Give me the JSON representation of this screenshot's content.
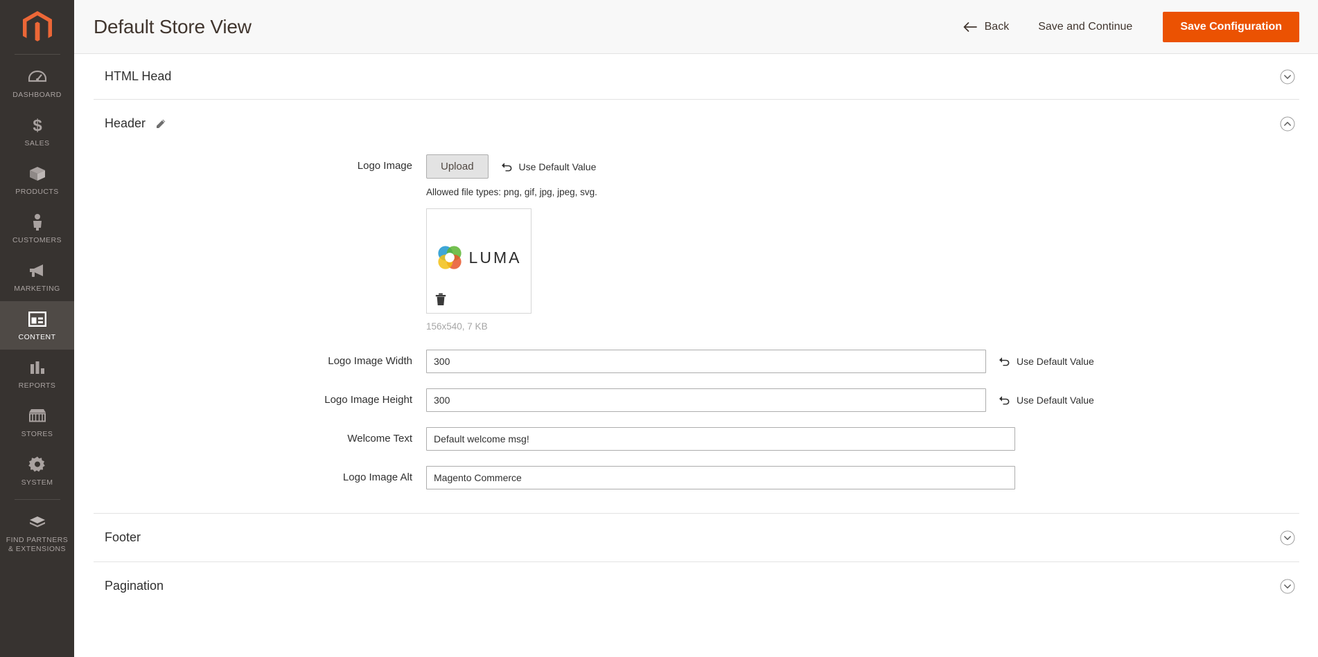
{
  "sidebar": {
    "logo_icon": "magento-logo-icon",
    "items": [
      {
        "label": "DASHBOARD",
        "icon": "dashboard-icon",
        "active": false
      },
      {
        "label": "SALES",
        "icon": "dollar-icon",
        "active": false
      },
      {
        "label": "PRODUCTS",
        "icon": "box-icon",
        "active": false
      },
      {
        "label": "CUSTOMERS",
        "icon": "person-icon",
        "active": false
      },
      {
        "label": "MARKETING",
        "icon": "megaphone-icon",
        "active": false
      },
      {
        "label": "CONTENT",
        "icon": "layout-icon",
        "active": true
      },
      {
        "label": "REPORTS",
        "icon": "bar-chart-icon",
        "active": false
      },
      {
        "label": "STORES",
        "icon": "store-icon",
        "active": false
      },
      {
        "label": "SYSTEM",
        "icon": "gear-icon",
        "active": false
      },
      {
        "label": "FIND PARTNERS\n& EXTENSIONS",
        "icon": "extension-icon",
        "active": false
      }
    ]
  },
  "header": {
    "title": "Default Store View",
    "back_label": "Back",
    "back_icon": "arrow-left-icon",
    "save_continue_label": "Save and Continue",
    "save_config_label": "Save Configuration",
    "primary_color": "#eb5202"
  },
  "sections": {
    "html_head": {
      "title": "HTML Head",
      "expanded": false,
      "chevron": "chevron-down-icon"
    },
    "header_section": {
      "title": "Header",
      "expanded": true,
      "chevron": "chevron-up-icon",
      "edit_icon": "pencil-icon"
    },
    "footer": {
      "title": "Footer",
      "expanded": false,
      "chevron": "chevron-down-icon"
    },
    "pagination": {
      "title": "Pagination",
      "expanded": false,
      "chevron": "chevron-down-icon"
    }
  },
  "fields": {
    "logo_image": {
      "label": "Logo Image",
      "upload_label": "Upload",
      "use_default_label": "Use Default Value",
      "revert_icon": "revert-arrow-icon",
      "note": "Allowed file types: png, gif, jpg, jpeg, svg.",
      "preview_alt": "LUMA",
      "preview_logo_text": "LUMA",
      "delete_icon": "trash-icon",
      "meta": "156x540, 7 KB"
    },
    "logo_width": {
      "label": "Logo Image Width",
      "value": "300",
      "use_default_label": "Use Default Value",
      "revert_icon": "revert-arrow-icon"
    },
    "logo_height": {
      "label": "Logo Image Height",
      "value": "300",
      "use_default_label": "Use Default Value",
      "revert_icon": "revert-arrow-icon"
    },
    "welcome_text": {
      "label": "Welcome Text",
      "value": "Default welcome msg!"
    },
    "logo_alt": {
      "label": "Logo Image Alt",
      "value": "Magento Commerce"
    }
  }
}
